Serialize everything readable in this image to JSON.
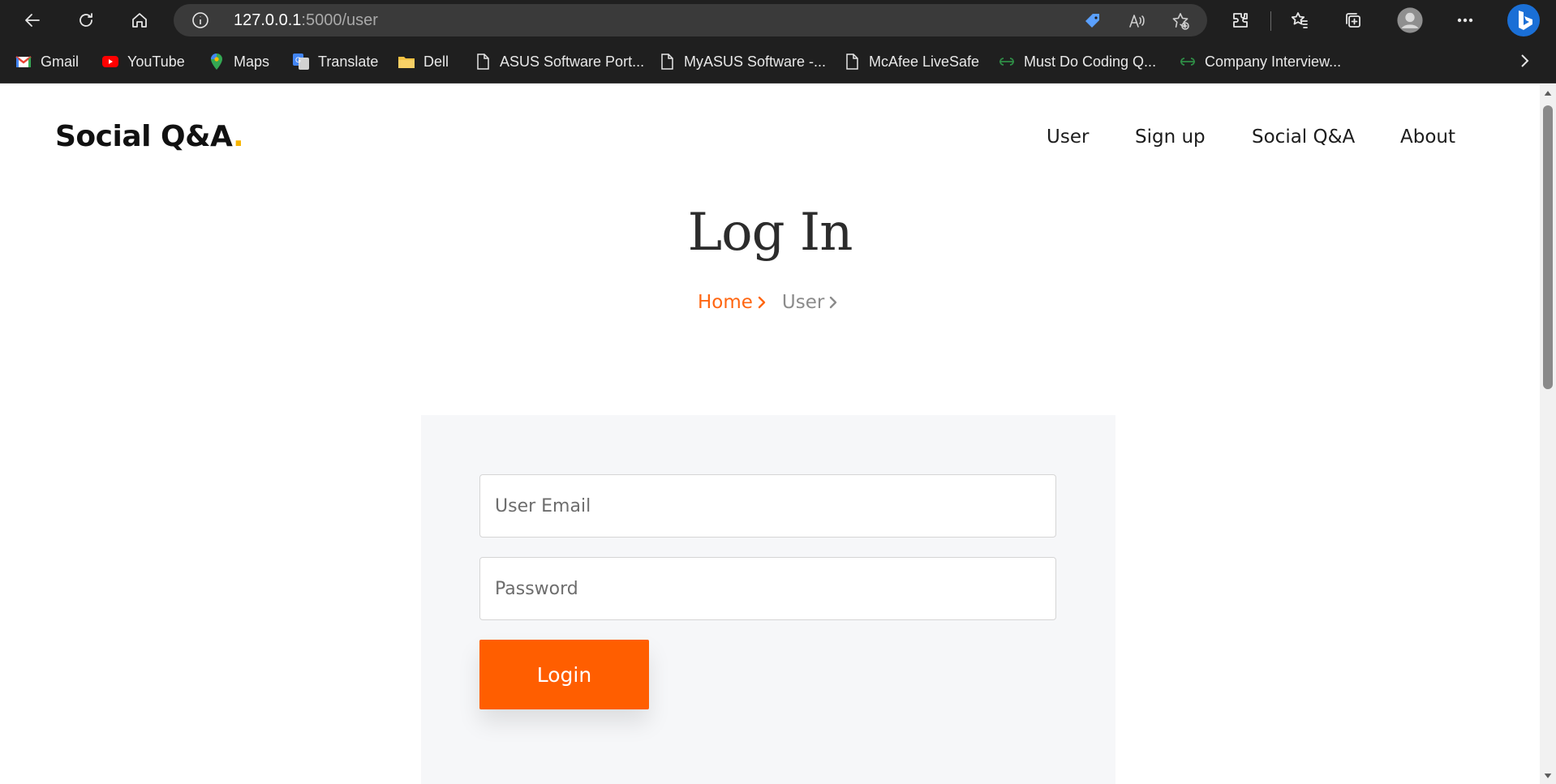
{
  "browser": {
    "address": {
      "host": "127.0.0.1",
      "rest": ":5000/user"
    },
    "bookmarks": [
      {
        "label": "Gmail",
        "icon": "gmail-icon"
      },
      {
        "label": "YouTube",
        "icon": "youtube-icon"
      },
      {
        "label": "Maps",
        "icon": "maps-icon"
      },
      {
        "label": "Translate",
        "icon": "translate-icon"
      },
      {
        "label": "Dell",
        "icon": "folder-icon"
      },
      {
        "label": "ASUS Software Port...",
        "icon": "page-icon"
      },
      {
        "label": "MyASUS Software -...",
        "icon": "page-icon"
      },
      {
        "label": "McAfee LiveSafe",
        "icon": "page-icon"
      },
      {
        "label": "Must Do Coding Q...",
        "icon": "gfg-icon"
      },
      {
        "label": "Company Interview...",
        "icon": "gfg-icon"
      }
    ]
  },
  "site": {
    "logo": {
      "text": "Social Q&A",
      "dot": "."
    },
    "nav": [
      "User",
      "Sign up",
      "Social Q&A",
      "About"
    ]
  },
  "hero": {
    "title": "Log In",
    "breadcrumb": {
      "home": "Home",
      "current": "User"
    }
  },
  "form": {
    "email_placeholder": "User Email",
    "password_placeholder": "Password",
    "submit_label": "Login"
  },
  "colors": {
    "accent": "#ff5e00",
    "logo_dot": "#f7b500",
    "panel_bg": "#f6f7f9"
  }
}
